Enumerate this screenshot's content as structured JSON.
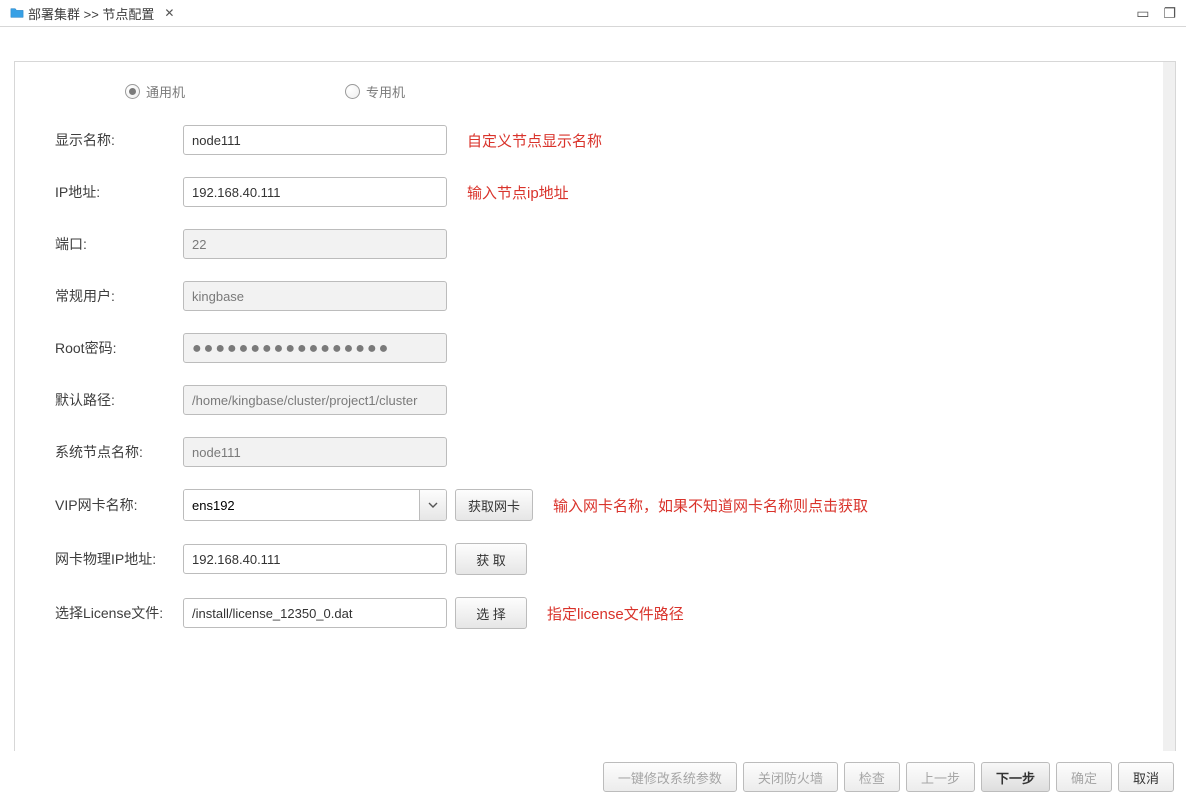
{
  "tab": {
    "title": "部署集群 >> 节点配置"
  },
  "radios": {
    "general": "通用机",
    "special": "专用机"
  },
  "fields": {
    "display_name": {
      "label": "显示名称:",
      "value": "node111"
    },
    "ip": {
      "label": "IP地址:",
      "value": "192.168.40.111"
    },
    "port": {
      "label": "端口:",
      "value": "22"
    },
    "user": {
      "label": "常规用户:",
      "value": "kingbase"
    },
    "root_pwd": {
      "label": "Root密码:",
      "value": "●●●●●●●●●●●●●●●●●"
    },
    "path": {
      "label": "默认路径:",
      "value": "/home/kingbase/cluster/project1/cluster"
    },
    "sys_node": {
      "label": "系统节点名称:",
      "value": "node111"
    },
    "vip_nic": {
      "label": "VIP网卡名称:",
      "value": "ens192",
      "btn": "获取网卡"
    },
    "nic_ip": {
      "label": "网卡物理IP地址:",
      "value": "192.168.40.111",
      "btn": "获  取"
    },
    "license": {
      "label": "选择License文件:",
      "value": "/install/license_12350_0.dat",
      "btn": "选  择"
    }
  },
  "hints": {
    "display_name": "自定义节点显示名称",
    "ip": "输入节点ip地址",
    "vip_nic": "输入网卡名称，如果不知道网卡名称则点击获取",
    "license": "指定license文件路径"
  },
  "footer": {
    "modify_params": "一键修改系统参数",
    "close_firewall": "关闭防火墙",
    "check": "检查",
    "prev": "上一步",
    "next": "下一步",
    "ok": "确定",
    "cancel": "取消"
  }
}
